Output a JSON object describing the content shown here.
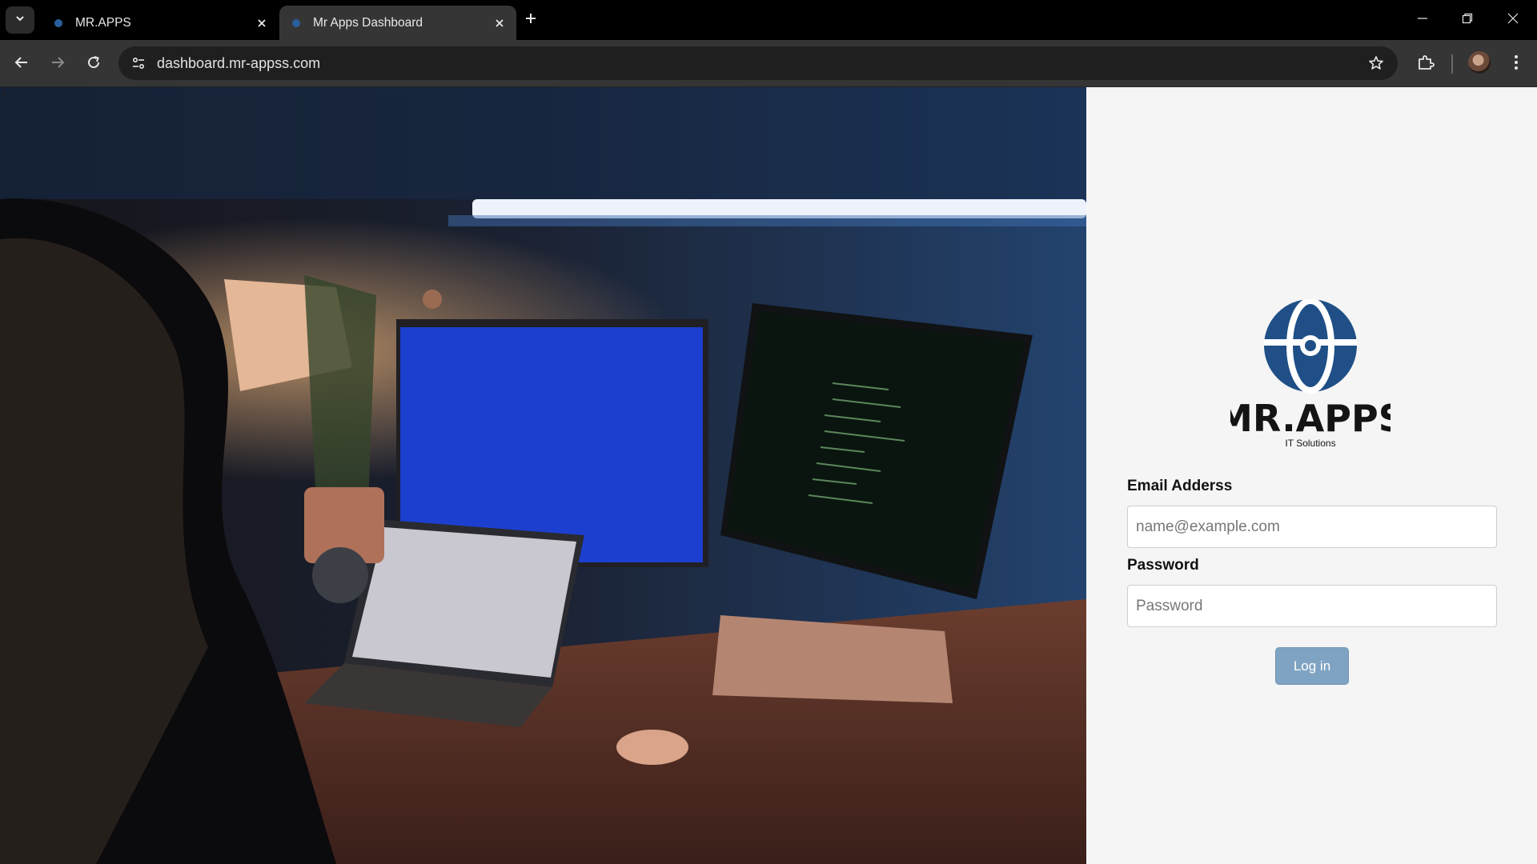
{
  "browser": {
    "tabs": [
      {
        "title": "MR.APPS",
        "active": false
      },
      {
        "title": "Mr Apps Dashboard",
        "active": true
      }
    ],
    "url": "dashboard.mr-appss.com"
  },
  "colors": {
    "tab_active_bg": "#353535",
    "toolbar_bg": "#353535",
    "omnibox_bg": "#1f1f1f",
    "login_panel_bg": "#f5f5f5",
    "login_button_bg": "#7fa3c2",
    "logo_blue": "#1f4f86"
  },
  "icons": {
    "tab_menu": "chevron-down-icon",
    "tab_close": "close-icon",
    "new_tab": "plus-icon",
    "back": "back-arrow-icon",
    "forward": "forward-arrow-icon",
    "reload": "reload-icon",
    "site_info": "tune-icon",
    "bookmark": "star-icon",
    "extensions": "puzzle-icon",
    "menu": "kebab-menu-icon"
  },
  "page": {
    "stray_text": "s",
    "logo": {
      "wordmark": "MR.APPS",
      "tagline": "IT Solutions"
    },
    "form": {
      "email_label": "Email Adderss",
      "email_placeholder": "name@example.com",
      "email_value": "",
      "password_label": "Password",
      "password_placeholder": "Password",
      "password_value": "",
      "submit_label": "Log in"
    }
  }
}
